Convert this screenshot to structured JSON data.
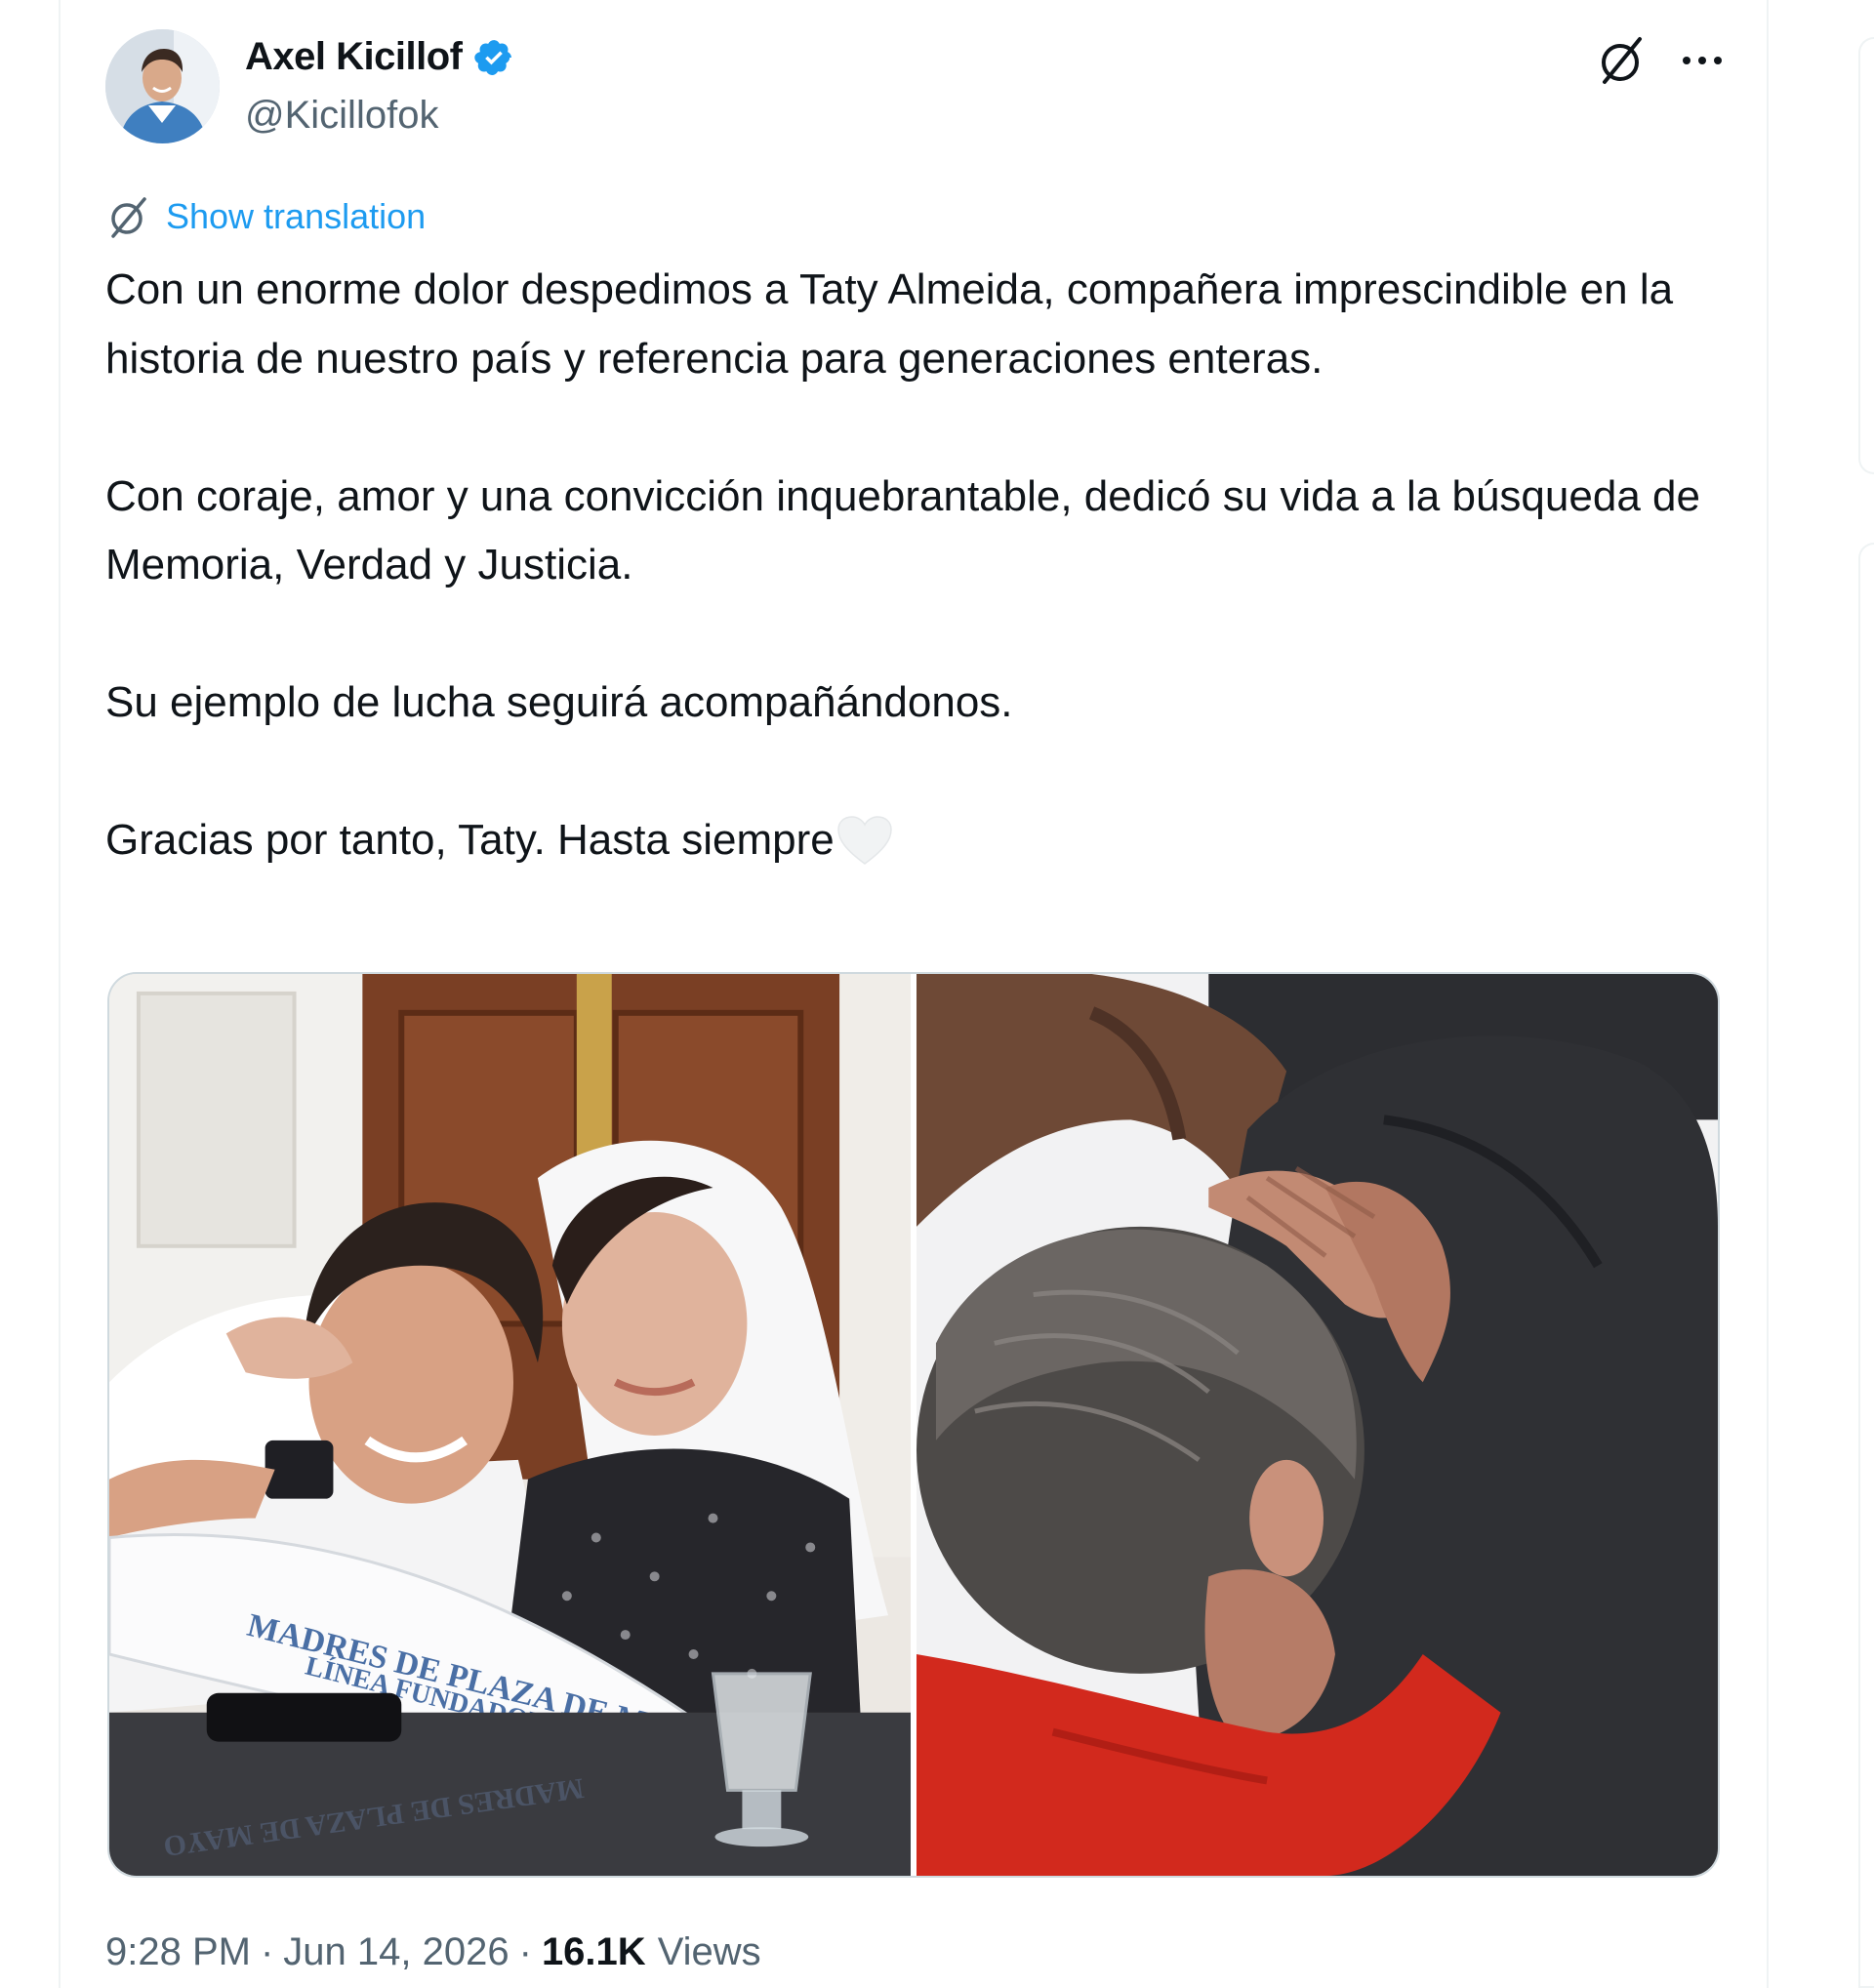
{
  "author": {
    "display_name": "Axel Kicillof",
    "handle": "@Kicillofok",
    "verified_color": "#1d9bf0",
    "avatar_icon": "profile-photo"
  },
  "actions": {
    "grok_icon": "grok-icon",
    "more_icon": "more-icon"
  },
  "translation": {
    "label": "Show translation",
    "icon": "translate-icon",
    "color": "#1d9bf0"
  },
  "tweet": {
    "paragraphs": [
      "Con un enorme dolor despedimos a Taty Almeida, compañera imprescindible en la historia de nuestro país y referencia para generaciones enteras.",
      "Con coraje, amor y una convicción inquebrantable, dedicó su vida a la búsqueda de Memoria, Verdad y Justicia.",
      "Su ejemplo de lucha seguirá acompañándonos.",
      "Gracias por tanto, Taty. Hasta siempre"
    ],
    "trailing_emoji": "white-heart"
  },
  "media": {
    "photos": [
      {
        "description_icon": "photo-man-and-woman-with-headscarf",
        "scarf_text": [
          "MADRES DE PLAZA DE MAYO",
          "LÍNEA FUNDADORA"
        ]
      },
      {
        "description_icon": "photo-embrace"
      }
    ]
  },
  "meta": {
    "time": "9:28 PM",
    "date": "Jun 14, 2026",
    "views_count": "16.1K",
    "views_label": "Views",
    "separator": "·"
  }
}
